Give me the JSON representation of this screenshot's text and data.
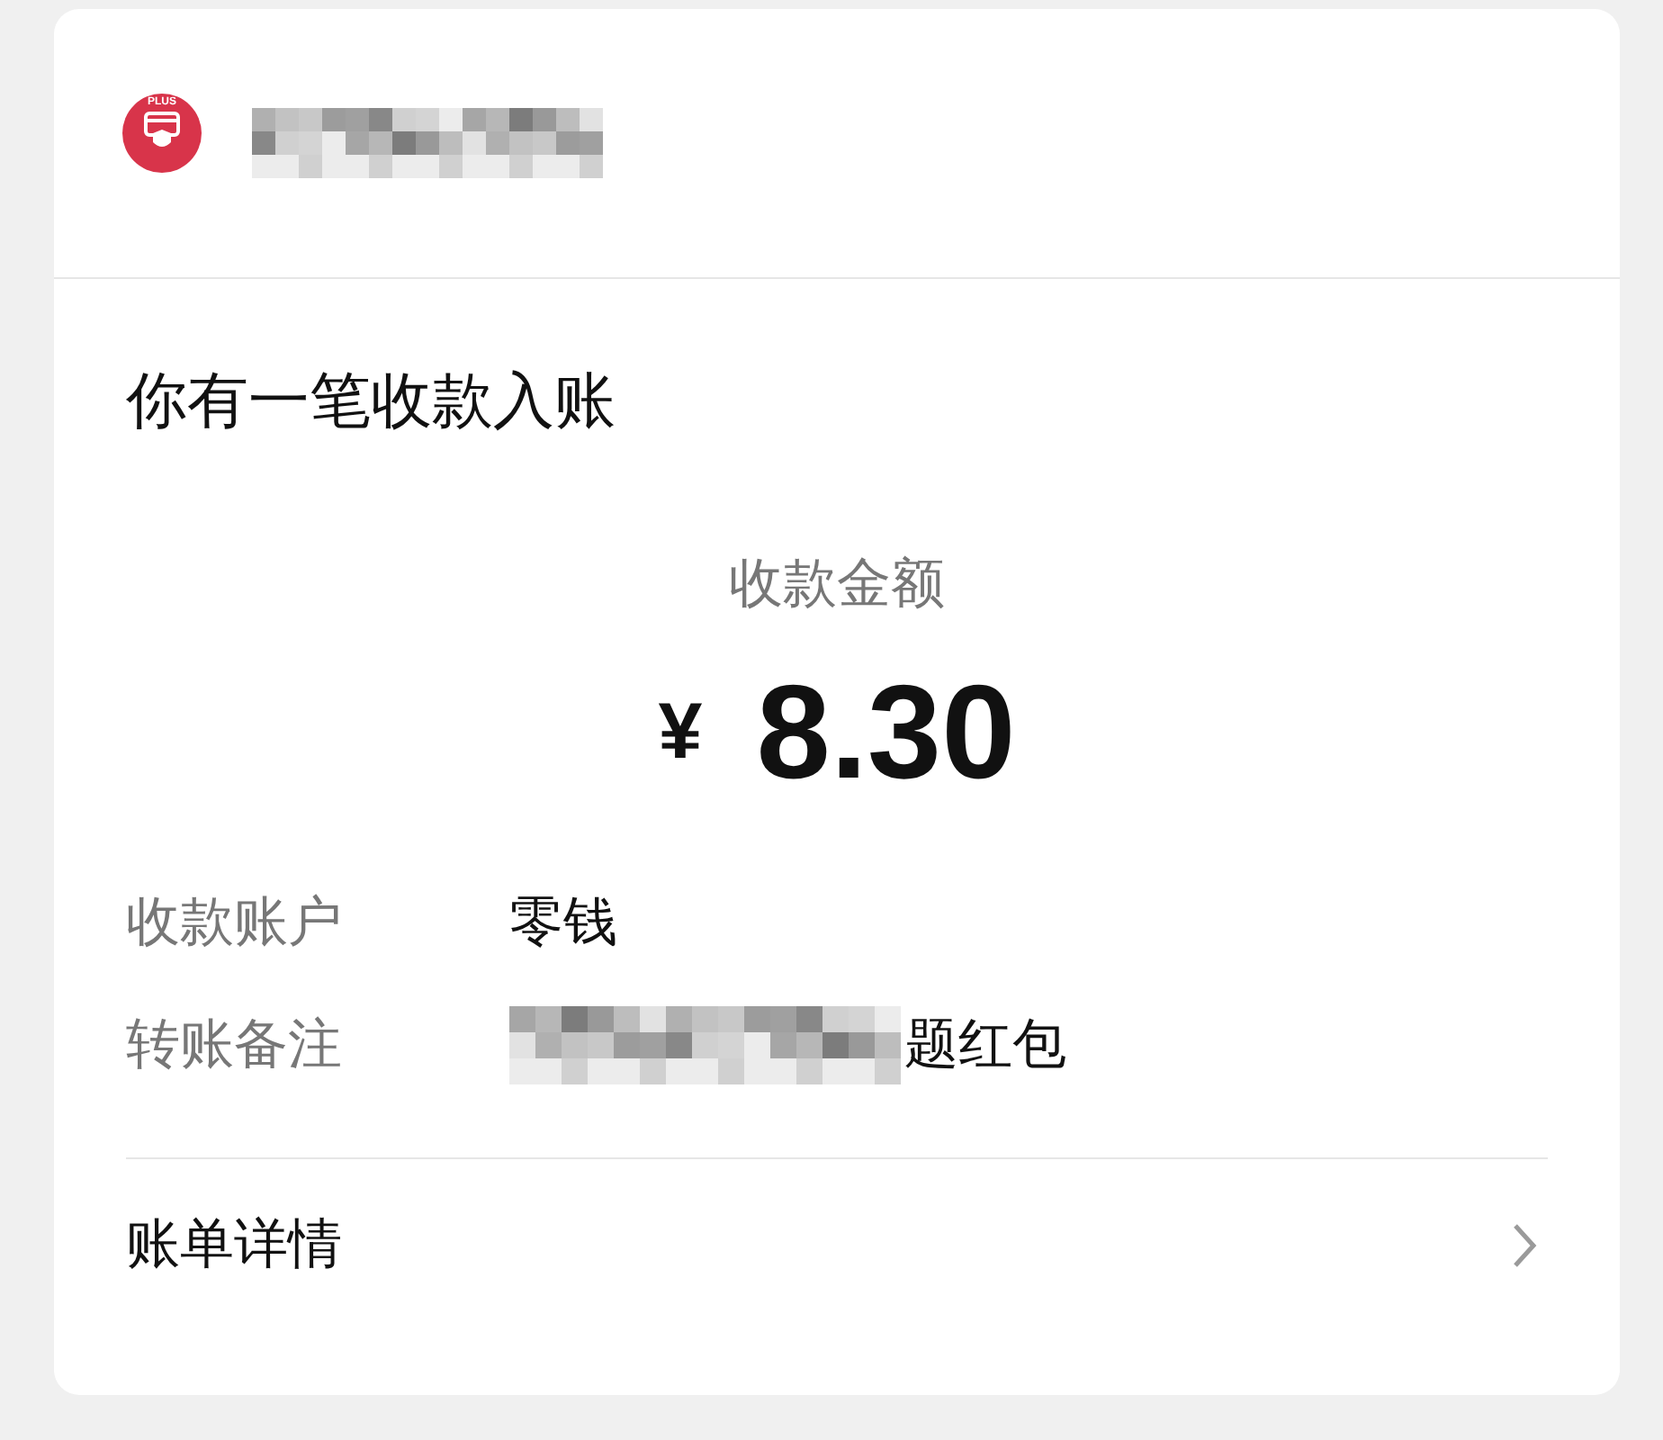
{
  "header": {
    "logo_badge": "PLUS",
    "app_name_obscured": true
  },
  "title": "你有一笔收款入账",
  "amount": {
    "label": "收款金额",
    "currency": "¥",
    "value": "8.30"
  },
  "details": [
    {
      "label": "收款账户",
      "value": "零钱",
      "obscured": false
    },
    {
      "label": "转账备注",
      "value": "题红包",
      "obscured": true
    }
  ],
  "footer_link": {
    "label": "账单详情"
  }
}
